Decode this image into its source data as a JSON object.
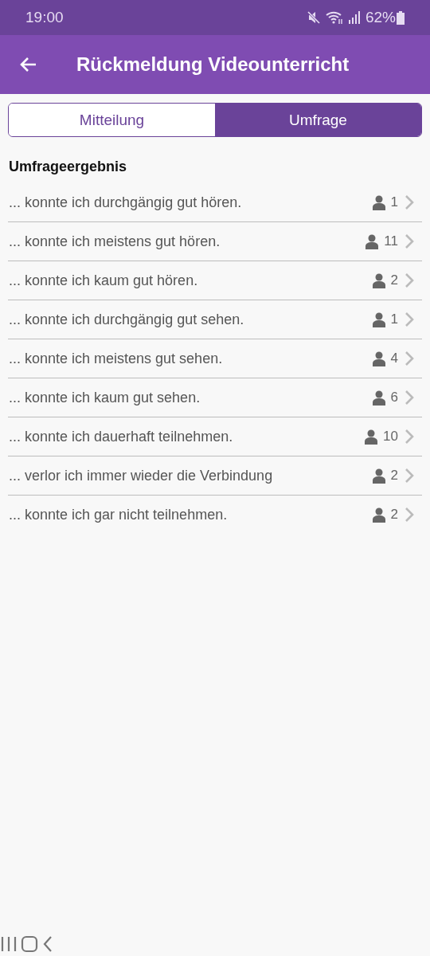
{
  "status_bar": {
    "time": "19:00",
    "battery": "62%"
  },
  "app_bar": {
    "title": "Rückmeldung Videounterricht"
  },
  "tabs": [
    {
      "label": "Mitteilung",
      "selected": false
    },
    {
      "label": "Umfrage",
      "selected": true
    }
  ],
  "section_title": "Umfrageergebnis",
  "results": [
    {
      "text": "... konnte ich durchgängig gut hören.",
      "count": "1"
    },
    {
      "text": "... konnte ich meistens gut hören.",
      "count": "11"
    },
    {
      "text": "... konnte ich kaum gut hören.",
      "count": "2"
    },
    {
      "text": "... konnte ich durchgängig gut sehen.",
      "count": "1"
    },
    {
      "text": "... konnte ich meistens gut sehen.",
      "count": "4"
    },
    {
      "text": "... konnte ich kaum gut sehen.",
      "count": "6"
    },
    {
      "text": "... konnte ich dauerhaft teilnehmen.",
      "count": "10"
    },
    {
      "text": "... verlor ich immer wieder die Verbindung",
      "count": "2"
    },
    {
      "text": "... konnte ich gar nicht teilnehmen.",
      "count": "2"
    }
  ]
}
